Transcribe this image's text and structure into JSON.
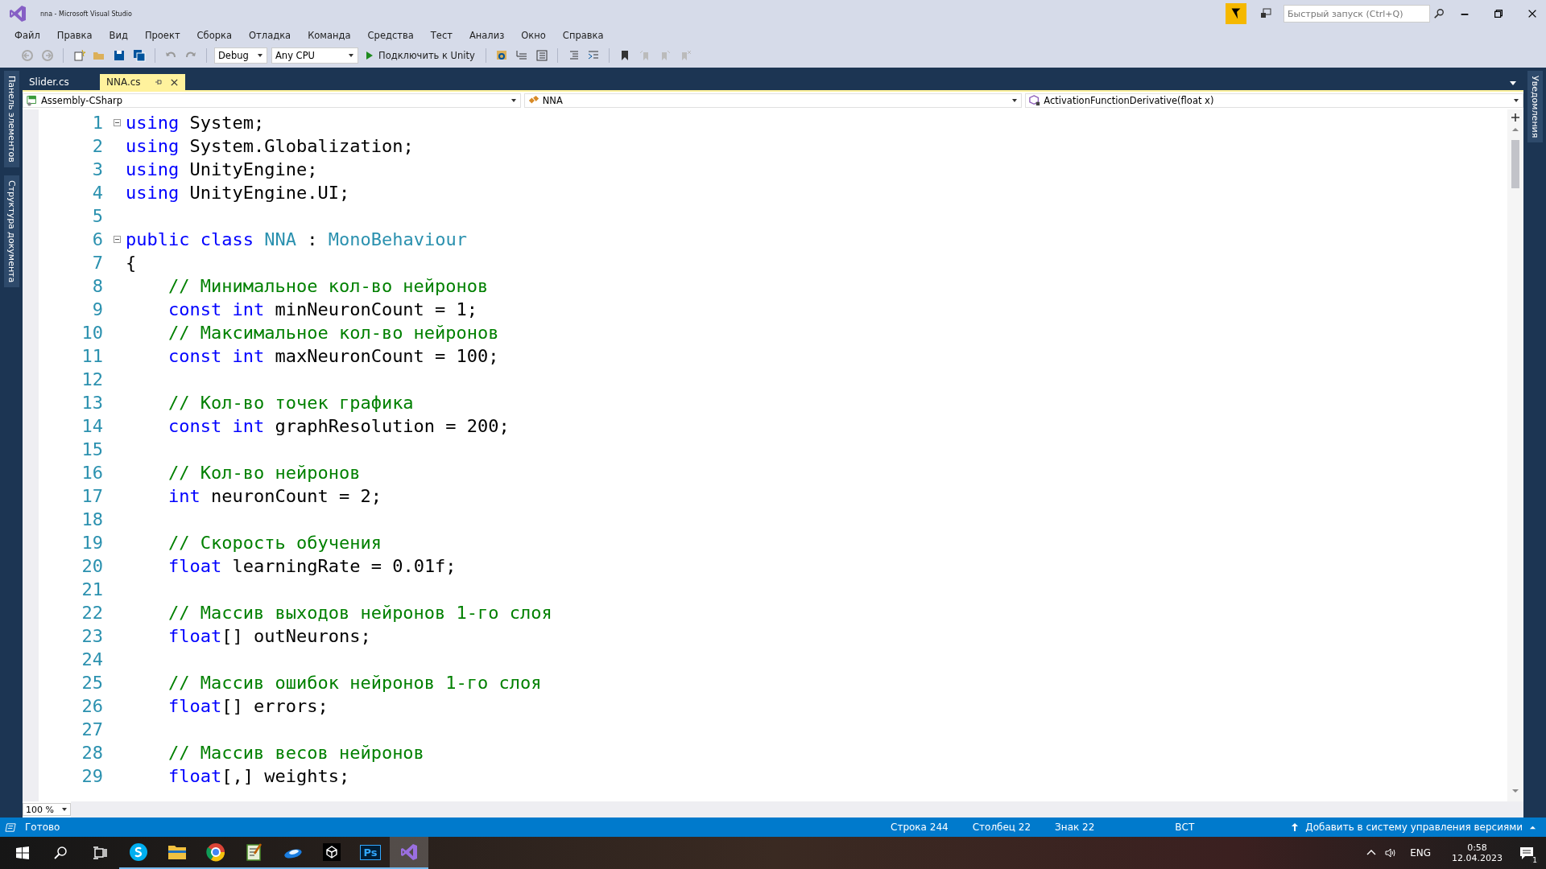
{
  "title_bar": {
    "title": "nna - Microsoft Visual Studio",
    "quick_launch_placeholder": "Быстрый запуск (Ctrl+Q)"
  },
  "menu": [
    "Файл",
    "Правка",
    "Вид",
    "Проект",
    "Сборка",
    "Отладка",
    "Команда",
    "Средства",
    "Тест",
    "Анализ",
    "Окно",
    "Справка"
  ],
  "toolbar": {
    "configuration": "Debug",
    "platform": "Any CPU",
    "run_label": "Подключить к Unity"
  },
  "side_panels_left": [
    "Панель элементов",
    "Структура документа"
  ],
  "side_panels_right": [
    "Уведомления"
  ],
  "tabs": [
    {
      "label": "Slider.cs",
      "selected": false
    },
    {
      "label": "NNA.cs",
      "selected": true
    }
  ],
  "nav_bar": {
    "project": "Assembly-CSharp",
    "class": "NNA",
    "member": "ActivationFunctionDerivative(float x)"
  },
  "code_lines": [
    {
      "number": "1",
      "collapsible": true,
      "tokens": [
        {
          "kind": "keyword",
          "text": "using"
        },
        {
          "kind": "plain",
          "text": " System;"
        }
      ]
    },
    {
      "number": "2",
      "collapsible": false,
      "tokens": [
        {
          "kind": "keyword",
          "text": "using"
        },
        {
          "kind": "plain",
          "text": " System.Globalization;"
        }
      ]
    },
    {
      "number": "3",
      "collapsible": false,
      "tokens": [
        {
          "kind": "keyword",
          "text": "using"
        },
        {
          "kind": "plain",
          "text": " UnityEngine;"
        }
      ]
    },
    {
      "number": "4",
      "collapsible": false,
      "tokens": [
        {
          "kind": "keyword",
          "text": "using"
        },
        {
          "kind": "plain",
          "text": " UnityEngine.UI;"
        }
      ]
    },
    {
      "number": "5",
      "collapsible": false
    },
    {
      "number": "6",
      "collapsible": true,
      "tokens": [
        {
          "kind": "keyword",
          "text": "public class "
        },
        {
          "kind": "type",
          "text": "NNA"
        },
        {
          "kind": "plain",
          "text": " : "
        },
        {
          "kind": "type",
          "text": "MonoBehaviour"
        }
      ]
    },
    {
      "number": "7",
      "collapsible": false,
      "tokens": [
        {
          "kind": "plain",
          "text": "{"
        }
      ]
    },
    {
      "number": "8",
      "collapsible": false,
      "tokens": [
        {
          "kind": "comment",
          "text": "    // Минимальное кол-во нейронов"
        }
      ]
    },
    {
      "number": "9",
      "collapsible": false,
      "tokens": [
        {
          "kind": "keyword",
          "text": "    const int"
        },
        {
          "kind": "plain",
          "text": " minNeuronCount = 1;"
        }
      ]
    },
    {
      "number": "10",
      "collapsible": false,
      "tokens": [
        {
          "kind": "comment",
          "text": "    // Максимальное кол-во нейронов"
        }
      ]
    },
    {
      "number": "11",
      "collapsible": false,
      "tokens": [
        {
          "kind": "keyword",
          "text": "    const int"
        },
        {
          "kind": "plain",
          "text": " maxNeuronCount = 100;"
        }
      ]
    },
    {
      "number": "12",
      "collapsible": false
    },
    {
      "number": "13",
      "collapsible": false,
      "tokens": [
        {
          "kind": "comment",
          "text": "    // Кол-во точек графика"
        }
      ]
    },
    {
      "number": "14",
      "collapsible": false,
      "tokens": [
        {
          "kind": "keyword",
          "text": "    const int"
        },
        {
          "kind": "plain",
          "text": " graphResolution = 200;"
        }
      ]
    },
    {
      "number": "15",
      "collapsible": false
    },
    {
      "number": "16",
      "collapsible": false,
      "tokens": [
        {
          "kind": "comment",
          "text": "    // Кол-во нейронов"
        }
      ]
    },
    {
      "number": "17",
      "collapsible": false,
      "tokens": [
        {
          "kind": "keyword",
          "text": "    int"
        },
        {
          "kind": "plain",
          "text": " neuronCount = 2;"
        }
      ]
    },
    {
      "number": "18",
      "collapsible": false
    },
    {
      "number": "19",
      "collapsible": false,
      "tokens": [
        {
          "kind": "comment",
          "text": "    // Скорость обучения"
        }
      ]
    },
    {
      "number": "20",
      "collapsible": false,
      "tokens": [
        {
          "kind": "keyword",
          "text": "    float"
        },
        {
          "kind": "plain",
          "text": " learningRate = 0.01f;"
        }
      ]
    },
    {
      "number": "21",
      "collapsible": false
    },
    {
      "number": "22",
      "collapsible": false,
      "tokens": [
        {
          "kind": "comment",
          "text": "    // Массив выходов нейронов 1-го слоя"
        }
      ]
    },
    {
      "number": "23",
      "collapsible": false,
      "tokens": [
        {
          "kind": "keyword",
          "text": "    float"
        },
        {
          "kind": "plain",
          "text": "[] outNeurons;"
        }
      ]
    },
    {
      "number": "24",
      "collapsible": false
    },
    {
      "number": "25",
      "collapsible": false,
      "tokens": [
        {
          "kind": "comment",
          "text": "    // Массив ошибок нейронов 1-го слоя"
        }
      ]
    },
    {
      "number": "26",
      "collapsible": false,
      "tokens": [
        {
          "kind": "keyword",
          "text": "    float"
        },
        {
          "kind": "plain",
          "text": "[] errors;"
        }
      ]
    },
    {
      "number": "27",
      "collapsible": false
    },
    {
      "number": "28",
      "collapsible": false,
      "tokens": [
        {
          "kind": "comment",
          "text": "    // Массив весов нейронов"
        }
      ]
    },
    {
      "number": "29",
      "collapsible": false,
      "tokens": [
        {
          "kind": "keyword",
          "text": "    float"
        },
        {
          "kind": "plain",
          "text": "[,] weights;"
        }
      ]
    }
  ],
  "zoom": "100 %",
  "status_bar": {
    "state": "Готово",
    "line": "Строка 244",
    "column": "Столбец 22",
    "char": "Знак 22",
    "mode": "ВСТ",
    "source_control": "Добавить в систему управления версиями"
  },
  "taskbar": {
    "apps": [
      {
        "kind": "skype",
        "active": false
      },
      {
        "kind": "folder",
        "active": false
      },
      {
        "kind": "browser",
        "active": false
      },
      {
        "kind": "notepad",
        "active": false
      },
      {
        "kind": "blue-app",
        "active": false
      },
      {
        "kind": "unity",
        "active": false
      },
      {
        "kind": "photoshop",
        "label": "Ps",
        "active": false
      },
      {
        "kind": "visual-studio",
        "active": true
      }
    ],
    "language": "ENG",
    "time": "0:58",
    "date": "12.04.2023",
    "notifications": "1"
  }
}
